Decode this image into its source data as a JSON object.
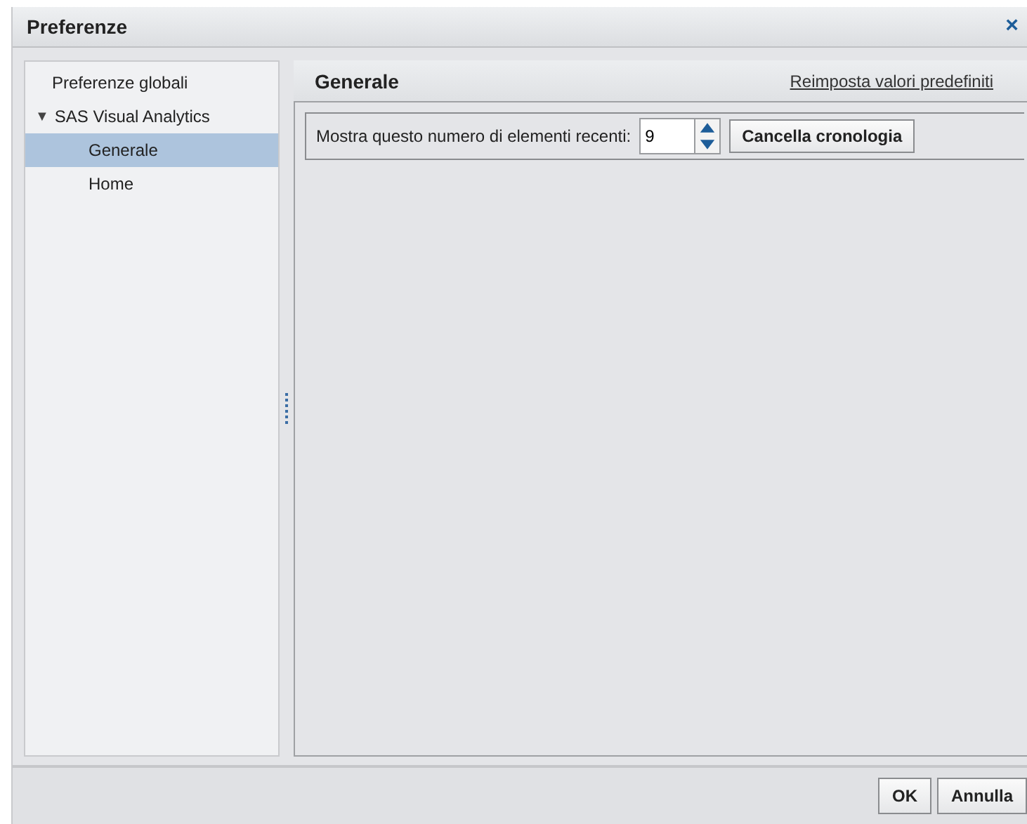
{
  "window": {
    "title": "Preferenze",
    "close": "×"
  },
  "tree": [
    {
      "label": "Preferenze globali",
      "selected": false
    },
    {
      "label": "SAS Visual Analytics",
      "selected": false,
      "expanded": true,
      "toggle": "▼",
      "children": [
        {
          "label": "Generale",
          "selected": true
        },
        {
          "label": "Home",
          "selected": false
        }
      ]
    }
  ],
  "panel": {
    "title": "Generale",
    "reset_link": "Reimposta valori predefiniti",
    "field_label": "Mostra questo numero di elementi recenti:",
    "spinner": {
      "value": "9"
    },
    "clear_button": "Cancella cronologia"
  },
  "buttons": [
    "OK",
    "Annulla"
  ]
}
